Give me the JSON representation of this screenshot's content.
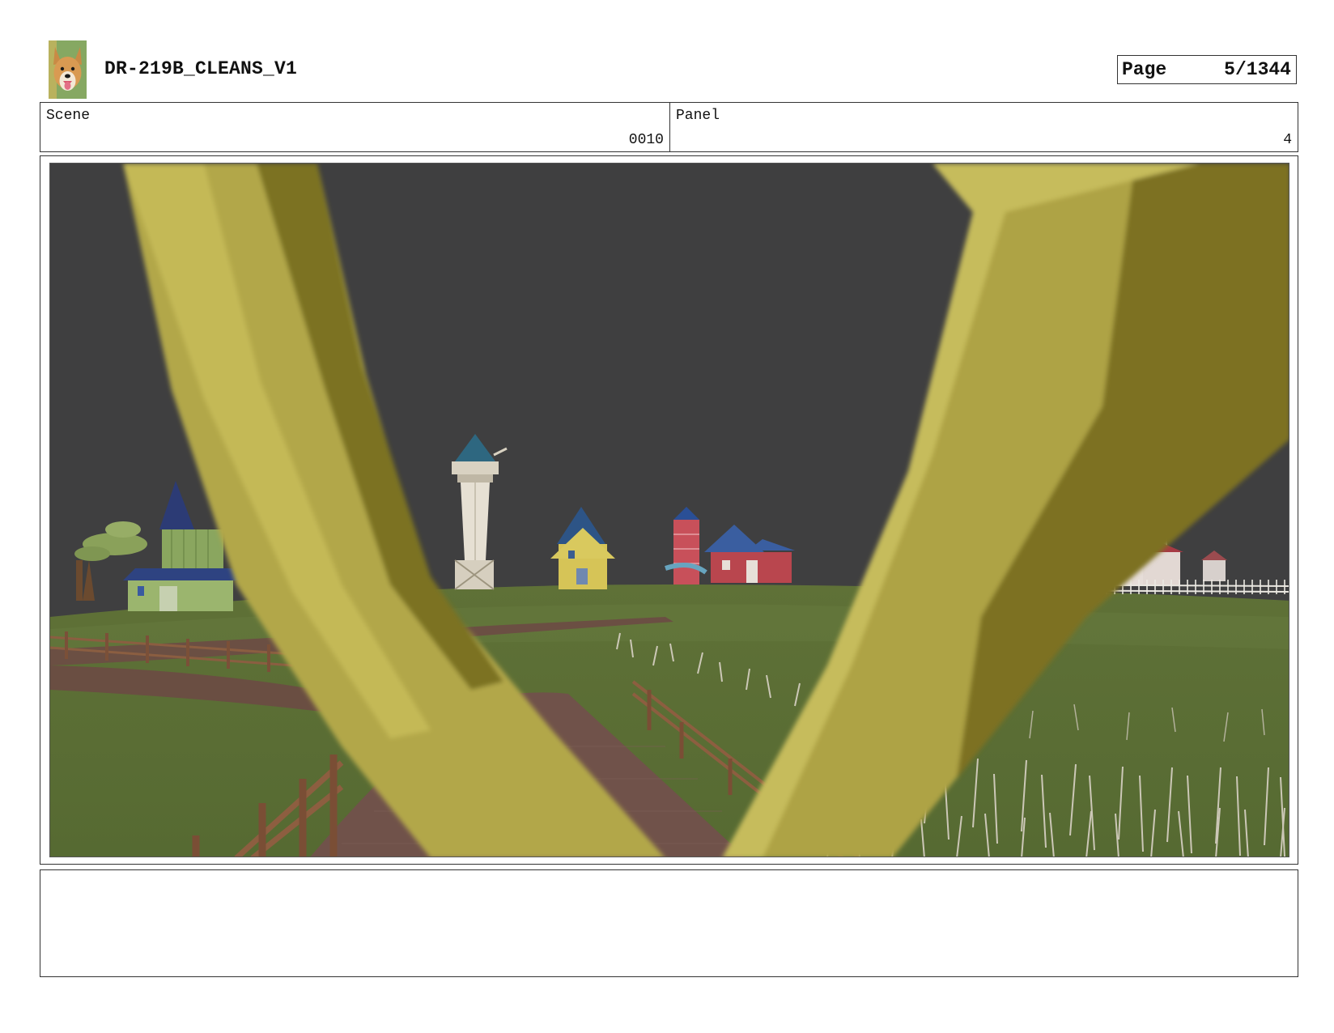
{
  "header": {
    "title": "DR-219B_CLEANS_V1",
    "logo_icon": "dog-avatar-icon",
    "page_label": "Page",
    "page_number": "5/1344"
  },
  "info": {
    "scene_label": "Scene",
    "scene_value": "0010",
    "panel_label": "Panel",
    "panel_value": "4"
  },
  "frame": {
    "image_icon": "storyboard-panel-image",
    "colors": {
      "sky": "#3f3f40",
      "grass": "#5b6e35",
      "path": "#6e4f45",
      "foreground_frame": "#b3a748"
    }
  },
  "notes": {
    "text": ""
  }
}
